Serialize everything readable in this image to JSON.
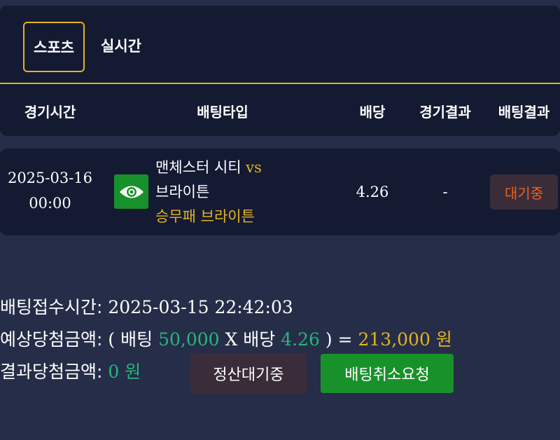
{
  "tabs": [
    {
      "label": "스포츠",
      "active": true
    },
    {
      "label": "실시간",
      "active": false
    }
  ],
  "header": {
    "time": "경기시간",
    "bet_type": "배팅타입",
    "odds": "배당",
    "game_result": "경기결과",
    "bet_result": "배팅결과"
  },
  "bet": {
    "date": "2025-03-16",
    "time": "00:00",
    "icon": "eye-icon",
    "home": "맨체스터 시티",
    "vs": "vs",
    "away": "브라이튼",
    "pick": "승무패 브라이튼",
    "odds": "4.26",
    "game_result": "-",
    "status": "대기중"
  },
  "summary": {
    "received_label": "배팅접수시간:",
    "received_value": "2025-03-15 22:42:03",
    "expected_label": "예상당첨금액:",
    "paren_open": "(",
    "bet_word": "배팅",
    "bet_amount": "50,000",
    "x_word": "X",
    "odds_word": "배당",
    "odds_value": "4.26",
    "paren_close": ") =",
    "expected_total": "213,000 원",
    "result_label": "결과당첨금액:",
    "result_value": "0 원"
  },
  "buttons": {
    "pending": "정산대기중",
    "cancel": "배팅취소요청"
  },
  "colors": {
    "background": "#262d48",
    "card": "#151a33",
    "accent": "#e2b422",
    "green": "#24b77c",
    "status": "#f0601c",
    "button_green": "#19912b"
  }
}
